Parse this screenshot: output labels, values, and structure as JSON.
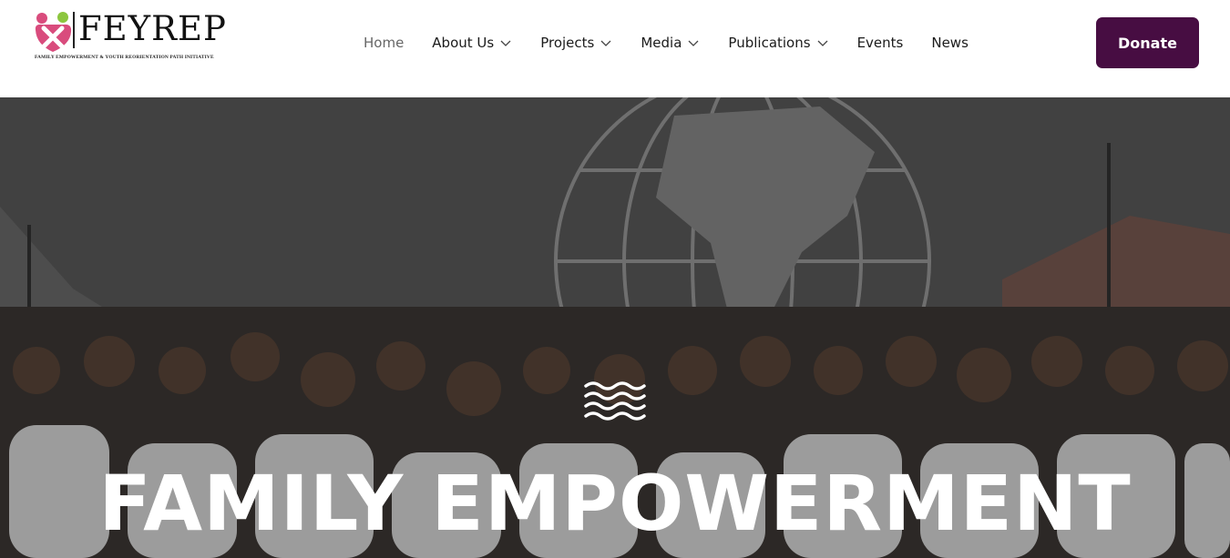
{
  "brand": {
    "name": "FEYREP",
    "tagline": "FAMILY EMPOWERMENT & YOUTH REORIENTATION PATH INITIATIVE",
    "colors": {
      "accent": "#470d42",
      "logo_pink": "#d94c7d",
      "logo_green": "#8cc63f"
    }
  },
  "nav": {
    "items": [
      {
        "label": "Home",
        "active": true,
        "dropdown": false
      },
      {
        "label": "About Us",
        "active": false,
        "dropdown": true
      },
      {
        "label": "Projects",
        "active": false,
        "dropdown": true
      },
      {
        "label": "Media",
        "active": false,
        "dropdown": true
      },
      {
        "label": "Publications",
        "active": false,
        "dropdown": true
      },
      {
        "label": "Events",
        "active": false,
        "dropdown": false
      },
      {
        "label": "News",
        "active": false,
        "dropdown": false
      }
    ],
    "chevron_icon": "chevron-down-icon"
  },
  "donate": {
    "label": "Donate"
  },
  "hero": {
    "icon": "waves-icon",
    "title": "FAMILY EMPOWERMENT"
  }
}
